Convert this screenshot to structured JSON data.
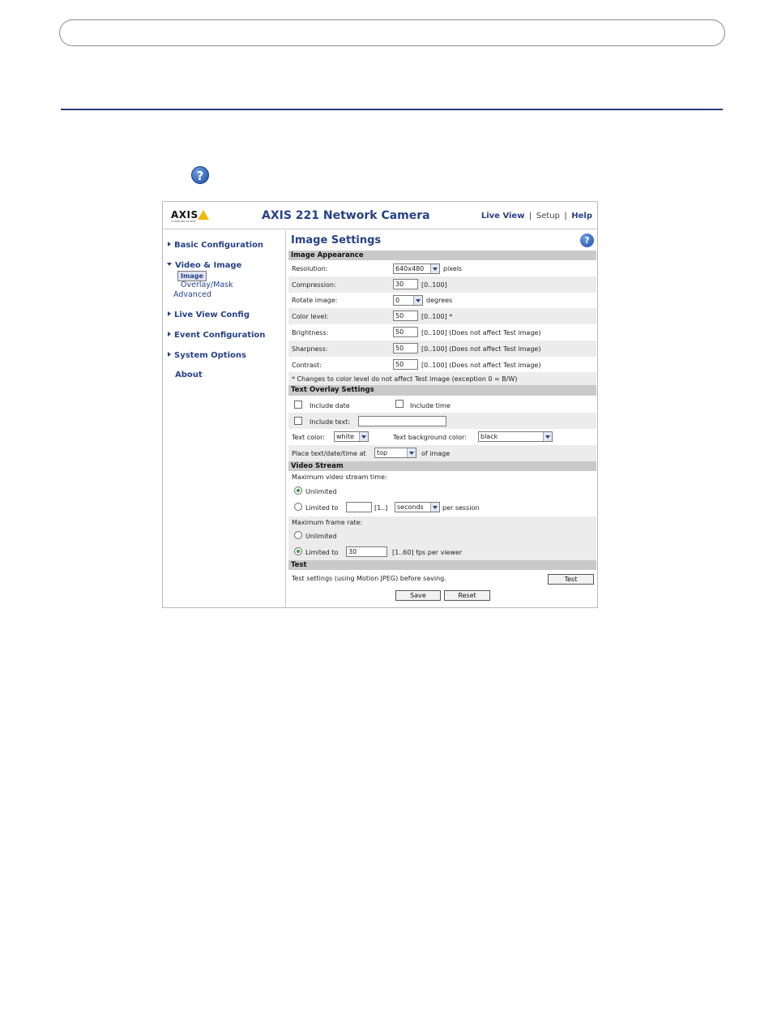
{
  "camera": {
    "logo_text": "AXIS",
    "logo_subtext": "COMMUNICATIONS",
    "title": "AXIS 221 Network Camera",
    "links": {
      "live_view": "Live View",
      "setup": "Setup",
      "help": "Help",
      "sep": "|"
    }
  },
  "sidebar": {
    "basic": "Basic Configuration",
    "video": "Video & Image",
    "image": "Image",
    "overlay": "Overlay/Mask",
    "advanced": "Advanced",
    "liveview": "Live View Config",
    "event": "Event Configuration",
    "system": "System Options",
    "about": "About"
  },
  "page": {
    "title": "Image Settings",
    "help_glyph": "?"
  },
  "appearance": {
    "header": "Image Appearance",
    "resolution_label": "Resolution:",
    "resolution_value": "640x480",
    "resolution_unit": "pixels",
    "compression_label": "Compression:",
    "compression_value": "30",
    "compression_range": "[0..100]",
    "rotate_label": "Rotate image:",
    "rotate_value": "0",
    "rotate_unit": "degrees",
    "color_label": "Color level:",
    "color_value": "50",
    "color_range": "[0..100] *",
    "brightness_label": "Brightness:",
    "brightness_value": "50",
    "brightness_range": "[0..100] (Does not affect Test image)",
    "sharpness_label": "Sharpness:",
    "sharpness_value": "50",
    "sharpness_range": "[0..100] (Does not affect Test image)",
    "contrast_label": "Contrast:",
    "contrast_value": "50",
    "contrast_range": "[0..100] (Does not affect Test image)",
    "note": "* Changes to color level do not affect Test image (exception 0 = B/W)"
  },
  "overlay": {
    "header": "Text Overlay Settings",
    "include_date": "Include date",
    "include_time": "Include time",
    "include_text": "Include text:",
    "include_text_value": "",
    "text_color_label": "Text color:",
    "text_color_value": "white",
    "bg_color_label": "Text background color:",
    "bg_color_value": "black",
    "place_label": "Place text/date/time at",
    "place_value": "top",
    "place_suffix": "of image"
  },
  "stream": {
    "header": "Video Stream",
    "max_time_label": "Maximum video stream time:",
    "unlimited": "Unlimited",
    "limited_to": "Limited to",
    "time_value": "",
    "time_range": "[1..]",
    "time_unit_value": "seconds",
    "per_session": "per session",
    "max_rate_label": "Maximum frame rate:",
    "rate_unlimited": "Unlimited",
    "rate_limited_to": "Limited to",
    "rate_value": "30",
    "rate_suffix": "[1..60] fps per viewer"
  },
  "test": {
    "header": "Test",
    "description": "Test settings (using Motion JPEG) before saving.",
    "test_button": "Test",
    "save_button": "Save",
    "reset_button": "Reset"
  }
}
